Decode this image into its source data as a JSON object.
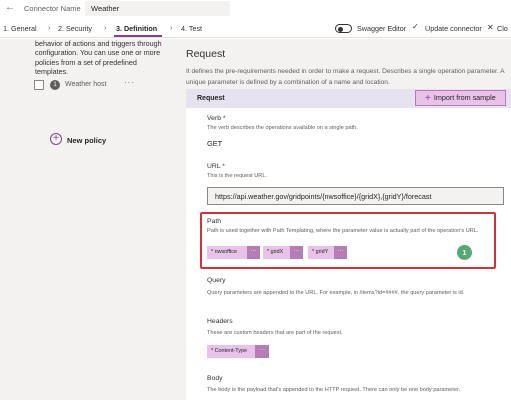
{
  "header": {
    "back_icon": "arrow-left-icon",
    "connector_name_label": "Connector Name",
    "connector_name_value": "Weather"
  },
  "tabs": [
    {
      "label": "1. General"
    },
    {
      "label": "2. Security"
    },
    {
      "label": "3. Definition",
      "active": true
    },
    {
      "label": "4. Test"
    }
  ],
  "toolbar": {
    "swagger_label": "Swagger Editor",
    "update_label": "Update connector",
    "close_label": "Clo"
  },
  "left": {
    "description": "behavior of actions and triggers through configuration. You can use one or more policies from a set of predefined templates.",
    "policy": {
      "number": "1",
      "name": "Weather host",
      "more": "···"
    },
    "new_policy_label": "New policy"
  },
  "main": {
    "title": "Request",
    "description": "It defines the pre-requirements needed in order to make a request. Describes a single operation parameter. A unique parameter is defined by a combination of a name and location.",
    "card_header": "Request",
    "import_label": "Import from sample",
    "verb": {
      "label": "Verb *",
      "help": "The verb describes the operations available on a single path.",
      "value": "GET"
    },
    "url": {
      "label": "URL *",
      "help": "This is the request URL.",
      "value": "https://api.weather.gov/gridpoints/{nwsoffice}/{gridX},{gridY}/forecast"
    },
    "path": {
      "label": "Path",
      "help": "Path is used together with Path Templating, where the parameter value is actually part of the operation's URL.",
      "chips": [
        "* nwsoffice",
        "* gridX",
        "* gridY"
      ],
      "chip_more": "···"
    },
    "step_badge": "1",
    "query": {
      "label": "Query",
      "help": "Query parameters are appended to the URL. For example, in /items?id=####, the query parameter is id."
    },
    "headers": {
      "label": "Headers",
      "help": "These are custom headers that are part of the request.",
      "chips": [
        "* Content-Type"
      ],
      "chip_more": "···"
    },
    "body": {
      "label": "Body",
      "help": "The body is the payload that's appended to the HTTP request. There can only be one body parameter."
    }
  },
  "colors": {
    "accent": "#8a3f8c",
    "chip": "#e9c2ea",
    "highlight": "#d13438",
    "badge": "#57a874"
  }
}
